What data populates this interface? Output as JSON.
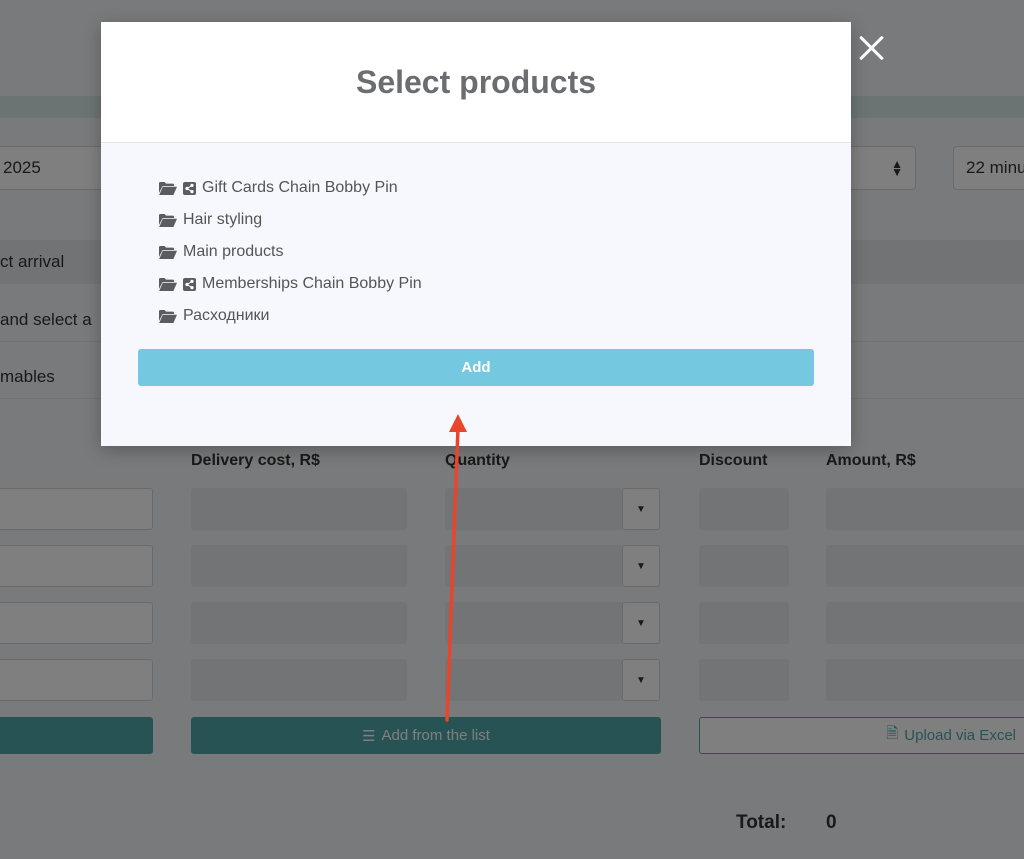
{
  "background": {
    "date_value": "2025",
    "minutes_value": "22 minu",
    "row_arrival": "ct arrival",
    "row_select": "and select a",
    "row_consumables": "mables",
    "columns": {
      "delivery_cost": "Delivery cost, R$",
      "quantity": "Quantity",
      "discount": "Discount",
      "amount": "Amount, R$"
    },
    "buttons": {
      "add_from_list": "Add from the list",
      "upload_excel": "Upload via Excel"
    },
    "total_label": "Total:",
    "total_value": "0"
  },
  "modal": {
    "title": "Select products",
    "items": [
      {
        "label": "Gift Cards Chain Bobby Pin",
        "shared": true
      },
      {
        "label": "Hair styling",
        "shared": false
      },
      {
        "label": "Main products",
        "shared": false
      },
      {
        "label": "Memberships Chain Bobby Pin",
        "shared": true
      },
      {
        "label": "Расходники",
        "shared": false
      }
    ],
    "add_label": "Add"
  },
  "colors": {
    "add_button": "#74c8df",
    "teal_button": "#4fa7a8",
    "arrow": "#e8452c"
  }
}
